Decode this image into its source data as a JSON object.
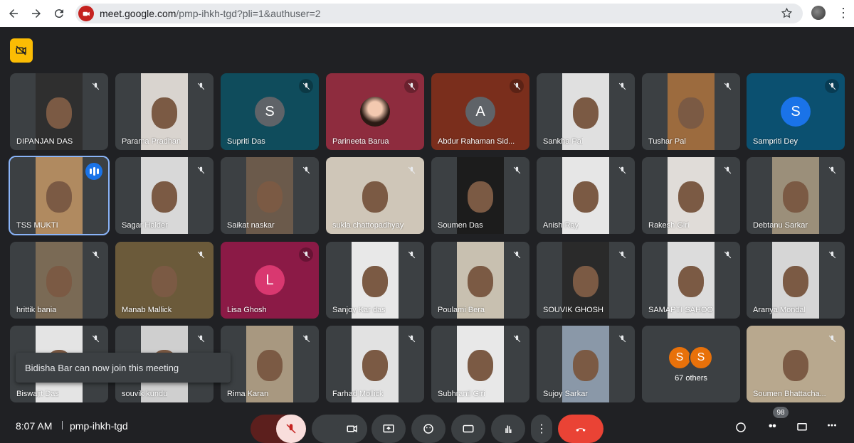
{
  "browser": {
    "url_host": "meet.google.com",
    "url_path": "/pmp-ihkh-tgd?pli=1&authuser=2"
  },
  "participants": [
    {
      "name": "DIPANJAN DAS",
      "type": "video",
      "bg": "#2f2f2f"
    },
    {
      "name": "Parama Pradhan",
      "type": "video",
      "bg": "#d9d4cf"
    },
    {
      "name": "Supriti Das",
      "type": "avatar",
      "initial": "S",
      "bg": "#0f4c5c",
      "avatar_color": "#5f6368"
    },
    {
      "name": "Parineeta Barua",
      "type": "photo",
      "bg": "#8e2c3e"
    },
    {
      "name": "Abdur Rahaman Sid...",
      "type": "avatar",
      "initial": "A",
      "bg": "#7a2e1c",
      "avatar_color": "#5f6368"
    },
    {
      "name": "Sankha Pal",
      "type": "video",
      "bg": "#e0e0e0"
    },
    {
      "name": "Tushar Pal",
      "type": "video",
      "bg": "#9c6b3e"
    },
    {
      "name": "Sampriti Dey",
      "type": "avatar",
      "initial": "S",
      "bg": "#0b5070",
      "avatar_color": "#1a73e8"
    },
    {
      "name": "TSS MUKTI",
      "type": "video",
      "bg": "#b08a60",
      "speaking": true
    },
    {
      "name": "Sagar Halder",
      "type": "video",
      "bg": "#d8d8d8"
    },
    {
      "name": "Saikat naskar",
      "type": "video",
      "bg": "#6b5a4b"
    },
    {
      "name": "sukla chattopadhyay",
      "type": "video",
      "bg": "#cfc6b8",
      "wide": true
    },
    {
      "name": "Soumen Das",
      "type": "video",
      "bg": "#1c1c1c"
    },
    {
      "name": "Anish Ray",
      "type": "video",
      "bg": "#e6e6e6"
    },
    {
      "name": "Rakesh Giri",
      "type": "video",
      "bg": "#e0dcd8"
    },
    {
      "name": "Debtanu Sarkar",
      "type": "video",
      "bg": "#9b8f7a"
    },
    {
      "name": "hrittik bania",
      "type": "video",
      "bg": "#7a6a55"
    },
    {
      "name": "Manab Mallick",
      "type": "video",
      "bg": "#6b5a3a",
      "wide": true
    },
    {
      "name": "Lisa Ghosh",
      "type": "avatar",
      "initial": "L",
      "bg": "#8b1a46",
      "avatar_color": "#d93870"
    },
    {
      "name": "Sanjoy Kar das",
      "type": "video",
      "bg": "#e8e8e8"
    },
    {
      "name": "Poulami Bera",
      "type": "video",
      "bg": "#c8c0b0"
    },
    {
      "name": "SOUVIK GHOSH",
      "type": "video",
      "bg": "#2a2a2a"
    },
    {
      "name": "SAMAPTI SAHOO",
      "type": "video",
      "bg": "#dcdcdc"
    },
    {
      "name": "Aranya Mondal",
      "type": "video",
      "bg": "#d6d6d6"
    },
    {
      "name": "Biswajit Das",
      "type": "video",
      "bg": "#e4e4e4"
    },
    {
      "name": "souvik kundu",
      "type": "video",
      "bg": "#cfcfcf"
    },
    {
      "name": "Rima Karan",
      "type": "video",
      "bg": "#a89880"
    },
    {
      "name": "Farhad Mollick",
      "type": "video",
      "bg": "#e2e2e2"
    },
    {
      "name": "Subhranil Giri",
      "type": "video",
      "bg": "#e8e8e8"
    },
    {
      "name": "Sujoy Sarkar",
      "type": "video",
      "bg": "#8a98a8"
    },
    {
      "name": "Soumen Bhattacha...",
      "type": "video",
      "bg": "#b8a88e",
      "wide": true
    }
  ],
  "others": {
    "label": "67 others",
    "initials": [
      "S",
      "S"
    ]
  },
  "toast": "Bidisha Bar can now join this meeting",
  "bottom": {
    "time": "8:07 AM",
    "meeting_code": "pmp-ihkh-tgd",
    "people_count": "98"
  },
  "colors": {
    "accent": "#8ab4f8",
    "end_call": "#ea4335",
    "cam_off_chip": "#fbbc04"
  }
}
